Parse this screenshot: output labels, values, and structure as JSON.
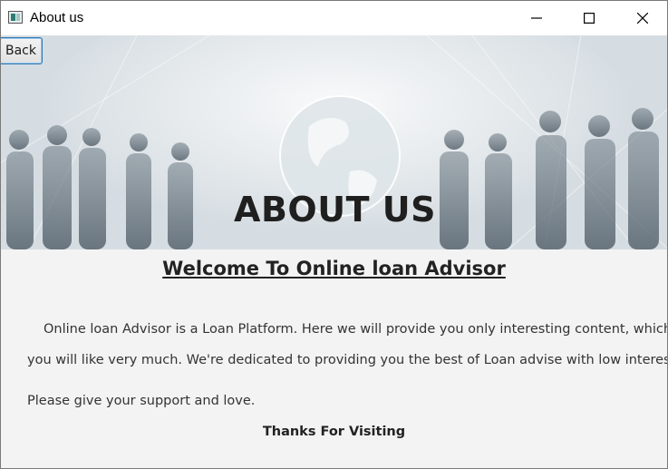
{
  "window": {
    "title": "About us",
    "controls": {
      "minimize": "minimize-icon",
      "maximize": "maximize-icon",
      "close": "close-icon"
    }
  },
  "banner": {
    "title": "ABOUT US",
    "back_label": "Back"
  },
  "content": {
    "heading": "Welcome To Online loan Advisor",
    "line1": "Online loan Advisor is a  Loan Platform. Here we will provide you only interesting content, which",
    "line2": "you will like very much. We're dedicated to providing you the best of Loan advise with low interest .",
    "line3": "Please give your support and love.",
    "thanks": "Thanks For Visiting"
  },
  "colors": {
    "back_border": "#2b78b5",
    "text": "#333333",
    "background": "#f3f3f3"
  }
}
